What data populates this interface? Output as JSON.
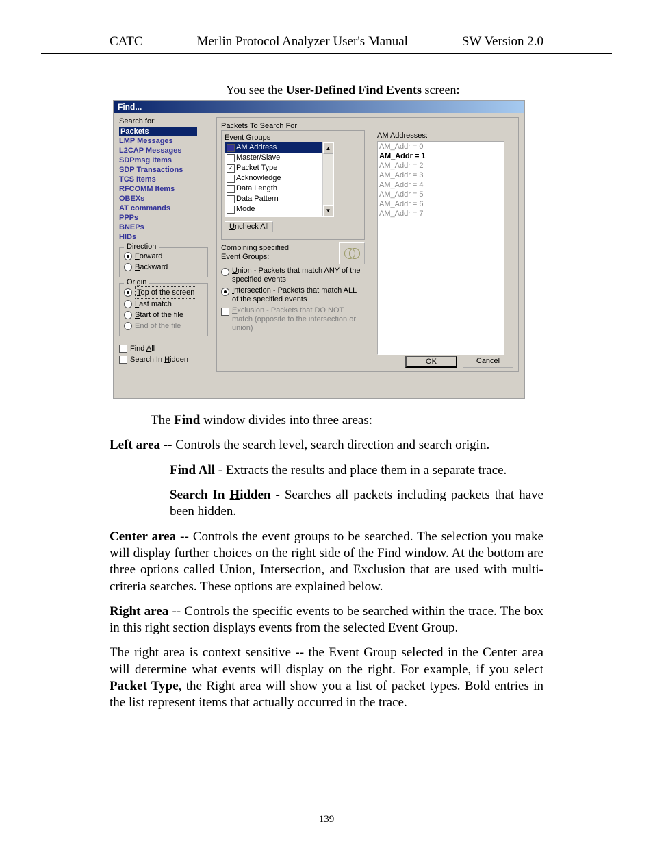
{
  "header": {
    "left": "CATC",
    "center": "Merlin Protocol Analyzer User's Manual",
    "right": "SW Version 2.0"
  },
  "intro_pre": "You see the ",
  "intro_bold": "User-Defined Find Events",
  "intro_post": " screen:",
  "dialog": {
    "title": "Find...",
    "search_for_label": "Search for:",
    "search_for_items": [
      "Packets",
      "LMP Messages",
      "L2CAP Messages",
      "SDPmsg Items",
      "SDP Transactions",
      "TCS Items",
      "RFCOMM Items",
      "OBEXs",
      "AT commands",
      "PPPs",
      "BNEPs",
      "HIDs"
    ],
    "direction_legend": "Direction",
    "direction_forward_pre": "F",
    "direction_forward": "orward",
    "direction_backward_pre": "B",
    "direction_backward": "ackward",
    "origin_legend": "Origin",
    "origin_top_pre": "T",
    "origin_top": "op of the screen",
    "origin_last_pre": "L",
    "origin_last": "ast match",
    "origin_start_pre": "S",
    "origin_start": "tart of the file",
    "origin_end_pre": "E",
    "origin_end": "nd of the file",
    "find_all_pre": "Find ",
    "find_all_u": "A",
    "find_all_post": "ll",
    "search_hidden_pre": "Search In ",
    "search_hidden_u": "H",
    "search_hidden_post": "idden",
    "packets_legend": "Packets To Search For",
    "eventgroups_legend": "Event Groups",
    "event_groups": [
      "AM Address",
      "Master/Slave",
      "Packet Type",
      "Acknowledge",
      "Data Length",
      "Data Pattern",
      "Mode"
    ],
    "event_groups_checked_index": 2,
    "uncheck_all_pre": "U",
    "uncheck_all": "ncheck All",
    "combining_label": "Combining specified Event Groups:",
    "union_u": "U",
    "union": "nion - Packets that match ANY of the specified events",
    "inter_u": "I",
    "inter": "ntersection - Packets that match ALL of the specified events",
    "excl_u": "E",
    "excl": "xclusion - Packets that DO NOT match (opposite to the intersection or union)",
    "am_addresses_label": "AM Addresses:",
    "am_addresses": [
      "AM_Addr = 0",
      "AM_Addr = 1",
      "AM_Addr = 2",
      "AM_Addr = 3",
      "AM_Addr = 4",
      "AM_Addr = 5",
      "AM_Addr = 6",
      "AM_Addr = 7"
    ],
    "ok": "OK",
    "cancel": "Cancel"
  },
  "para1_pre": "The ",
  "para1_bold": "Find",
  "para1_post": " window divides into three areas:",
  "left_area_bold": "Left area",
  "left_area_post": " --  Controls the search level, search direction and search origin.",
  "find_all_b1": "Find ",
  "find_all_u": "A",
  "find_all_b2": "ll",
  "find_all_desc": " -  Extracts the results and place them in a separate trace.",
  "search_hidden_b1": "Search In ",
  "search_hidden_u": "H",
  "search_hidden_b2": "idden",
  "search_hidden_desc": " - Searches all packets including packets that have been hidden.",
  "center_area_bold": "Center area",
  "center_area_post": " -- Controls the event groups to be searched. The selection you make will display further choices on the right side of the Find window.  At the bottom are three options called Union, Intersection, and Exclusion that are used with multi-criteria searches. These options are explained below.",
  "right_area_bold": "Right area",
  "right_area_post": " -- Controls the specific events to be searched within the trace.  The box in this right section displays events from the selected Event Group.",
  "para_context_pre": "The right area is context sensitive -- the Event Group selected in the Center area will determine what events will display on the right.  For example, if you select ",
  "para_context_bold": "Packet Type",
  "para_context_post": ", the Right area will show you a list of packet types.  Bold entries in the list represent items that actually occurred in the trace.",
  "page_number": "139"
}
